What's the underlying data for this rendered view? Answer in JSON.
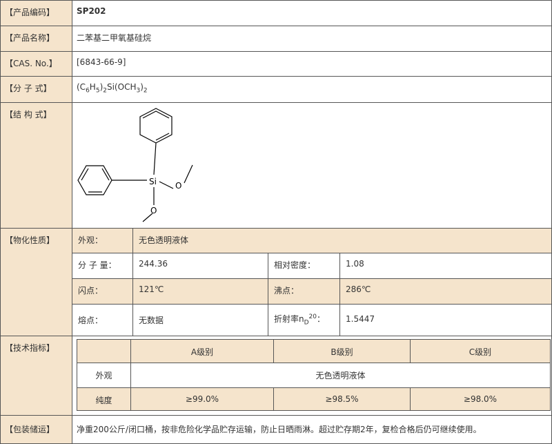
{
  "code": {
    "label": "【产品编码】",
    "value": "SP202"
  },
  "name": {
    "label": "【产品名称】",
    "value": "二苯基二甲氧基硅烷"
  },
  "cas": {
    "label": "【CAS. No.】",
    "value": "[6843-66-9]"
  },
  "formula": {
    "label": "【分 子 式】",
    "p1": "(C",
    "s1": "6",
    "p2": "H",
    "s2": "5",
    "p3": ")",
    "s3": "2",
    "p4": "Si(OCH",
    "s4": "3",
    "p5": ")",
    "s5": "2"
  },
  "structure": {
    "label": "【结 构 式】",
    "atoms": {
      "si": "Si",
      "o1": "O",
      "o2": "O"
    }
  },
  "props": {
    "label": "【物化性质】",
    "appearance_label": "外观：",
    "appearance_value": "无色透明液体",
    "mw_label": "分 子 量：",
    "mw_value": "244.36",
    "density_label": "相对密度：",
    "density_value": "1.08",
    "flash_label": "闪点：",
    "flash_value": "121℃",
    "bp_label": "沸点：",
    "bp_value": "286℃",
    "mp_label": "熔点：",
    "mp_value": "无数据",
    "ri_label_a": "折射率n",
    "ri_sub": "D",
    "ri_sup": "20",
    "ri_label_b": "：",
    "ri_value": "1.5447"
  },
  "spec": {
    "label": "【技术指标】",
    "grades": [
      "A级别",
      "B级别",
      "C级别"
    ],
    "appearance_label": "外观",
    "appearance_value": "无色透明液体",
    "purity_label": "纯度",
    "purity_values": [
      "≥99.0%",
      "≥98.5%",
      "≥98.0%"
    ]
  },
  "package": {
    "label": "【包装储运】",
    "value": "净重200公斤/闭口桶，按非危险化学品贮存运输，防止日晒雨淋。超过贮存期2年，复检合格后仍可继续使用。"
  }
}
